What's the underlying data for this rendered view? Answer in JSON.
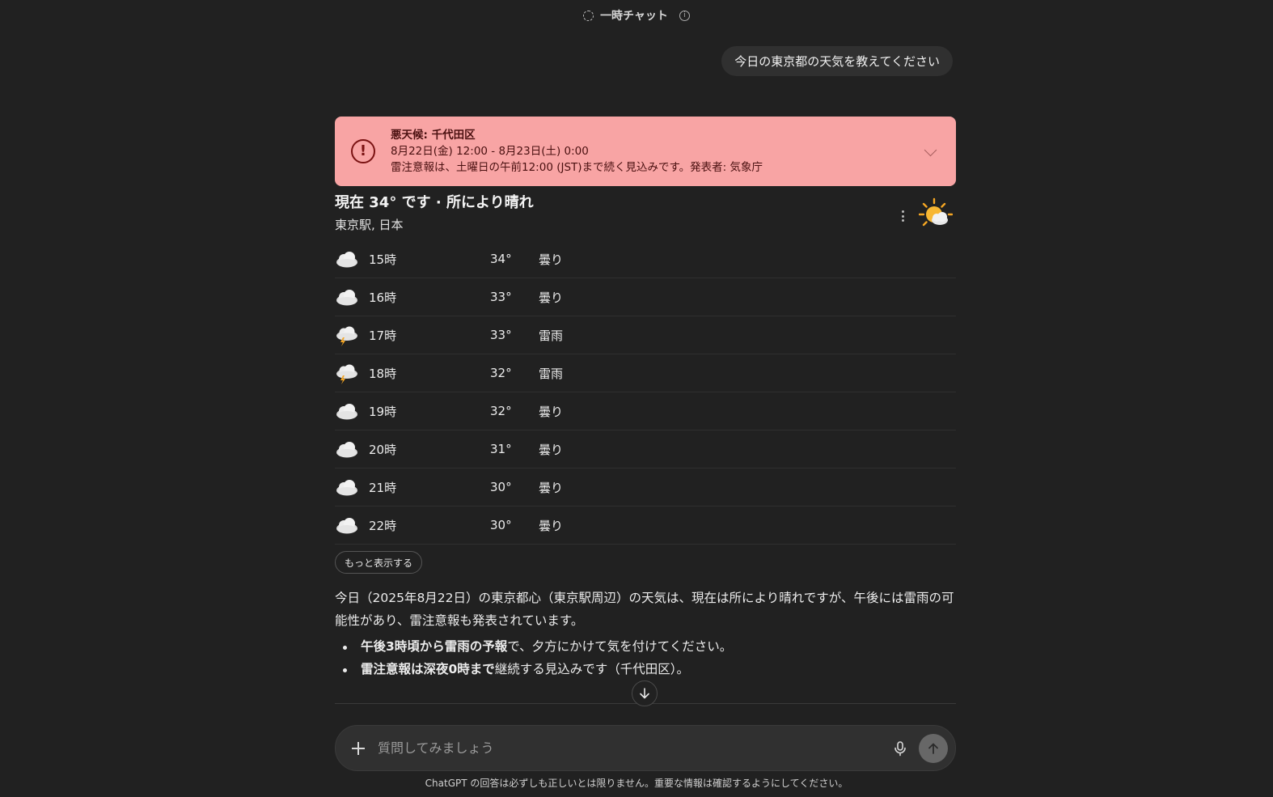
{
  "header": {
    "title": "一時チャット",
    "icons": [
      "temporary-chat-icon",
      "info-icon"
    ]
  },
  "conversation": {
    "user_message": "今日の東京都の天気を教えてください"
  },
  "alert": {
    "title": "悪天候: 千代田区",
    "period": "8月22日(金) 12:00 - 8月23日(土) 0:00",
    "detail": "雷注意報は、土曜日の午前12:00 (JST)まで続く見込みです。発表者: 気象庁",
    "icon": "exclamation-circle-icon",
    "background": "#f8a4a4"
  },
  "weather": {
    "current": "現在 34° です · 所により晴れ",
    "location": "東京駅, 日本",
    "current_icon": "sun-behind-cloud-icon",
    "hourly": [
      {
        "time": "15時",
        "temp": "34°",
        "condition": "曇り",
        "icon": "cloud-icon"
      },
      {
        "time": "16時",
        "temp": "33°",
        "condition": "曇り",
        "icon": "cloud-icon"
      },
      {
        "time": "17時",
        "temp": "33°",
        "condition": "雷雨",
        "icon": "thunderstorm-icon"
      },
      {
        "time": "18時",
        "temp": "32°",
        "condition": "雷雨",
        "icon": "thunderstorm-icon"
      },
      {
        "time": "19時",
        "temp": "32°",
        "condition": "曇り",
        "icon": "cloud-icon"
      },
      {
        "time": "20時",
        "temp": "31°",
        "condition": "曇り",
        "icon": "cloud-icon"
      },
      {
        "time": "21時",
        "temp": "30°",
        "condition": "曇り",
        "icon": "cloud-icon"
      },
      {
        "time": "22時",
        "temp": "30°",
        "condition": "曇り",
        "icon": "cloud-icon"
      }
    ],
    "more_label": "もっと表示する"
  },
  "summary": {
    "paragraph": "今日（2025年8月22日）の東京都心（東京駅周辺）の天気は、現在は所により晴れですが、午後には雷雨の可能性があり、雷注意報も発表されています。",
    "bullets": [
      {
        "bold": "午後3時頃から雷雨の予報",
        "rest": "で、夕方にかけて気を付けてください。"
      },
      {
        "bold": "雷注意報は深夜0時まで",
        "rest": "継続する見込みです（千代田区）。"
      }
    ]
  },
  "composer": {
    "placeholder": "質問してみましょう"
  },
  "footer": {
    "disclaimer": "ChatGPT の回答は必ずしも正しいとは限りません。重要な情報は確認するようにしてください。"
  }
}
